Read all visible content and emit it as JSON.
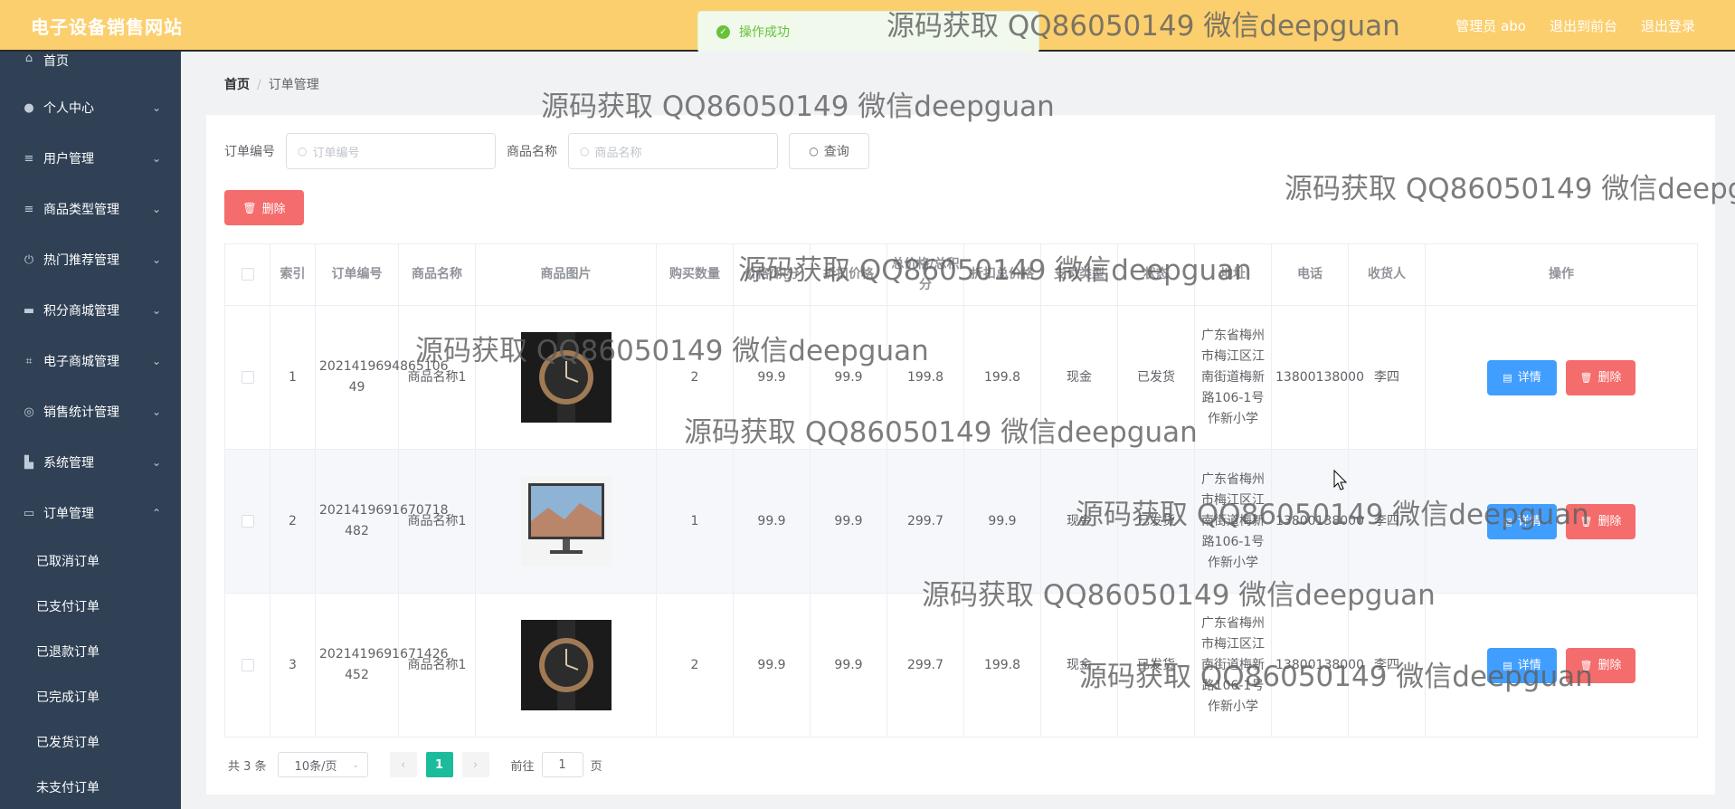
{
  "header": {
    "logo": "电子设备销售网站",
    "links": [
      "管理员 abo",
      "退出到前台",
      "退出登录"
    ]
  },
  "toast": {
    "text": "操作成功"
  },
  "sidebar": {
    "items": [
      {
        "label": "首页",
        "icon": "home-icon"
      },
      {
        "label": "个人中心",
        "icon": "user-icon"
      },
      {
        "label": "用户管理",
        "icon": "list-icon"
      },
      {
        "label": "商品类型管理",
        "icon": "list-icon"
      },
      {
        "label": "热门推荐管理",
        "icon": "power-icon"
      },
      {
        "label": "积分商城管理",
        "icon": "monitor-icon"
      },
      {
        "label": "电子商城管理",
        "icon": "crop-icon"
      },
      {
        "label": "销售统计管理",
        "icon": "compass-icon"
      },
      {
        "label": "系统管理",
        "icon": "toolbox-icon"
      },
      {
        "label": "订单管理",
        "icon": "chat-icon"
      }
    ],
    "sub_items": [
      "已取消订单",
      "已支付订单",
      "已退款订单",
      "已完成订单",
      "已发货订单",
      "未支付订单"
    ]
  },
  "breadcrumb": {
    "home": "首页",
    "current": "订单管理"
  },
  "search": {
    "order_no_label": "订单编号",
    "order_no_placeholder": "订单编号",
    "product_label": "商品名称",
    "product_placeholder": "商品名称",
    "query_label": "查询"
  },
  "toolbar": {
    "delete_label": "删除"
  },
  "table": {
    "headers": [
      "索引",
      "订单编号",
      "商品名称",
      "商品图片",
      "购买数量",
      "价格/积分",
      "折扣价格",
      "总价格/总积分",
      "折扣总价格",
      "支付类型",
      "状态",
      "地址",
      "电话",
      "收货人",
      "操作"
    ],
    "rows": [
      {
        "index": "1",
        "order_no": "2021419694865106 49",
        "product": "商品名称1",
        "image": "watch",
        "qty": "2",
        "price": "99.9",
        "discount": "99.9",
        "total": "199.8",
        "discount_total": "199.8",
        "pay_type": "现金",
        "status": "已发货",
        "address": "广东省梅州市梅江区江南街道梅新路106-1号作新小学",
        "phone": "13800138000",
        "receiver": "李四"
      },
      {
        "index": "2",
        "order_no": "2021419691670718 482",
        "product": "商品名称1",
        "image": "monitor",
        "qty": "1",
        "price": "99.9",
        "discount": "99.9",
        "total": "299.7",
        "discount_total": "99.9",
        "pay_type": "现金",
        "status": "已发货",
        "address": "广东省梅州市梅江区江南街道梅新路106-1号作新小学",
        "phone": "13800138000",
        "receiver": "李四"
      },
      {
        "index": "3",
        "order_no": "2021419691671426 452",
        "product": "商品名称1",
        "image": "watch",
        "qty": "2",
        "price": "99.9",
        "discount": "99.9",
        "total": "299.7",
        "discount_total": "199.8",
        "pay_type": "现金",
        "status": "已发货",
        "address": "广东省梅州市梅江区江南街道梅新路106-1号作新小学",
        "phone": "13800138000",
        "receiver": "李四"
      }
    ],
    "detail_label": "详情",
    "delete_label": "删除"
  },
  "pagination": {
    "total": "共 3 条",
    "page_size": "10条/页",
    "current_page": "1",
    "goto_prefix": "前往",
    "goto_value": "1",
    "goto_suffix": "页"
  },
  "watermark": "源码获取 QQ86050149 微信deepguan"
}
